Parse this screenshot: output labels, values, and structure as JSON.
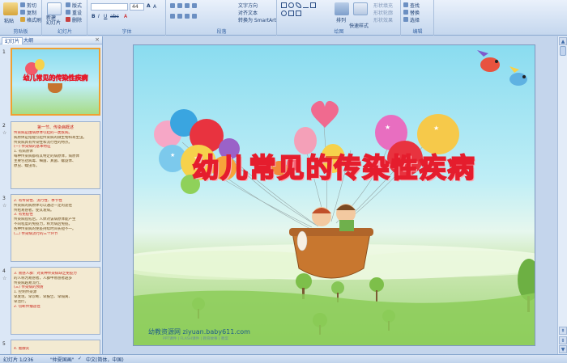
{
  "ribbon": {
    "clipboard": {
      "label": "剪贴板",
      "paste": "粘贴",
      "cut": "剪切",
      "copy": "复制",
      "format_painter": "格式刷"
    },
    "slides": {
      "label": "幻灯片",
      "new_slide": "新建\n幻灯片",
      "layout": "版式",
      "reset": "重设",
      "delete": "删除"
    },
    "font": {
      "label": "字体",
      "font_name": "",
      "font_size": "44"
    },
    "paragraph": {
      "label": "段落",
      "text_direction": "文字方向",
      "align_text": "对齐文本",
      "smartart": "转换为 SmartArt"
    },
    "drawing": {
      "label": "绘图",
      "arrange": "排列",
      "quick_styles": "快速样式",
      "shape_fill": "形状填充",
      "shape_outline": "形状轮廓",
      "shape_effects": "形状效果"
    },
    "editing": {
      "label": "编辑",
      "find": "查找",
      "replace": "替换",
      "select": "选择"
    }
  },
  "panel": {
    "tabs": [
      "幻灯片",
      "大纲"
    ],
    "close": "×",
    "thumbs": [
      {
        "num": "1",
        "title": "幼儿常见的传染性疾病"
      },
      {
        "num": "2",
        "heading": "第一节、传染病概述",
        "lines": [
          "传染病是由病原体引起的一类疾病。",
          "病原体是指能引起传染病的微生物和寄生虫。",
          "传染病具有传染性和流行性的特点。",
          "(一) 传染病的基本特征",
          "1. 有病原体",
          "每种传染病都有其特定的病原体，病原体",
          "主要包括病毒、细菌、真菌、螺旋体、",
          "原虫、蠕虫等。"
        ]
      },
      {
        "num": "3",
        "lines": [
          "2. 有传染性、流行性、季节性",
          "传染病的病原体可以通过一定的途径",
          "传给易感者，使其发病。",
          "3. 有免疫性",
          "传染病痊愈后，人体对该病原体能产生",
          "不同程度的免疫力，称为病后免疫。",
          "各种传染病的免疫持续时间长短不一。",
          "(二) 传染病流行的三个环节"
        ]
      },
      {
        "num": "4",
        "lines": [
          "3. 易感人群：对某种传染病缺乏免疫力",
          "的人称为易感者，人群中易感者越多",
          "传染病越易流行。",
          "(三) 传染病的预防",
          "1. 控制传染源",
          "早发现、早诊断、早报告、早隔离、",
          "早治疗。",
          "2. 切断传播途径"
        ]
      },
      {
        "num": "5",
        "lines": [
          "4. 腮腺炎"
        ]
      }
    ]
  },
  "slide": {
    "title": "幼儿常见的传染性疾病",
    "footer_site": "幼教资源网 ziyuan.baby611.com",
    "footer_sub": "PPT课件 | FLASH课件 | 教育故事 | 教案"
  },
  "status": {
    "slide_count": "幻灯片 1/236",
    "theme": "\"仲夏国画\"",
    "language": "中文(简体，中国)"
  }
}
